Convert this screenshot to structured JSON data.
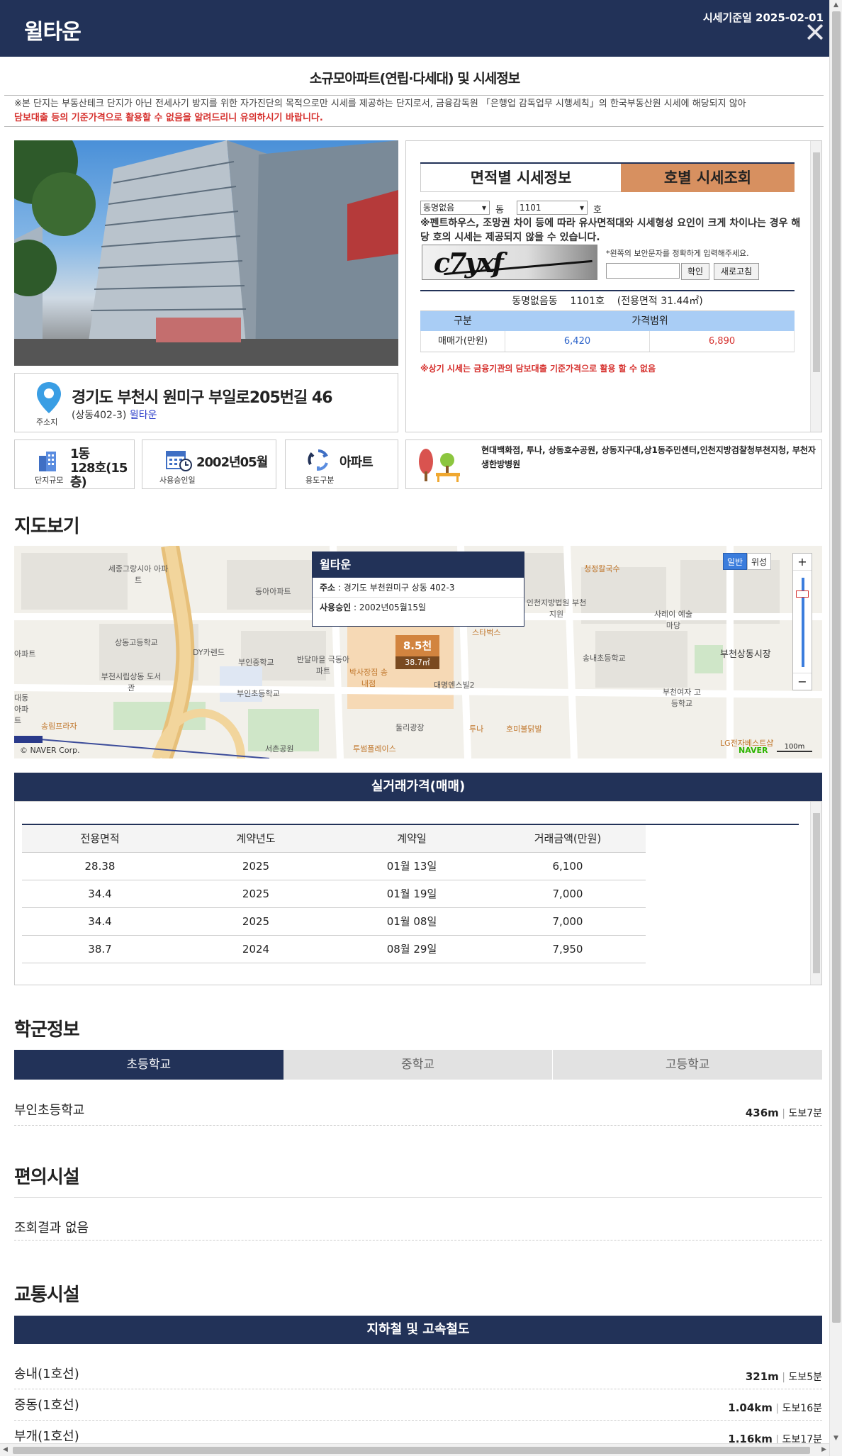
{
  "header": {
    "brand": "윌타운",
    "date_label": "시세기준일 2025-02-01",
    "close_icon": "close-icon"
  },
  "title": "소규모아파트(연립·다세대) 및 시세정보",
  "notice": {
    "line1": "※본 단지는 부동산테크 단지가 아닌 전세사기 방지를 위한 자가진단의 목적으로만 시세를 제공하는 단지로서, 금융감독원 「은행업 감독업무 시행세칙」의 한국부동산원 시세에 해당되지 않아",
    "line2": "담보대출 등의 기준가격으로 활용할 수 없음을 알려드리니 유의하시기 바랍니다."
  },
  "address": {
    "label": "주소지",
    "main": "경기도 부천시 원미구 부일로205번길 46",
    "sub_prefix": "(상동402-3)",
    "sub_link": "윌타운"
  },
  "price_panel": {
    "tab_area": "면적별 시세정보",
    "tab_unit": "호별 시세조회",
    "dong_value": "동명없음",
    "dong_suffix": "동",
    "ho_value": "1101",
    "ho_suffix": "호",
    "warning": "※펜트하우스, 조망권 차이 등에 따라 유사면적대와 시세형성 요인이 크게 차이나는 경우 해당 호의 시세는 제공되지 않을 수 있습니다.",
    "captcha_text": "c7yxf",
    "captcha_note": "*왼쪽의 보안문자를 정확하게 입력해주세요.",
    "confirm_btn": "확인",
    "refresh_btn": "새로고침",
    "result_caption": "동명없음동    1101호    (전용면적 31.44㎡)",
    "col_type": "구분",
    "col_range": "가격범위",
    "row_label": "매매가(만원)",
    "low": "6,420",
    "high": "6,890",
    "red_note": "※상기 시세는 금융기관의 담보대출 기준가격으로 활용 할 수 없음"
  },
  "info": {
    "scale_label": "단지규모",
    "scale_v1": "1동",
    "scale_v2": "128호(15층)",
    "approve_label": "사용승인일",
    "approve_value": "2002년05월",
    "use_label": "용도구분",
    "use_value": "아파트",
    "facilities": "현대백화점, 투나, 상동호수공원, 상동지구대,상1동주민센터,인천지방검찰청부천지청, 부천자생한방병원"
  },
  "map": {
    "section_title": "지도보기",
    "popup_title": "윌타운",
    "popup_addr_label": "주소",
    "popup_addr": " : 경기도 부천원미구 상동 402-3",
    "popup_date_label": "사용승인",
    "popup_date": " : 2002년05월15일",
    "marker_price": "8.5천",
    "marker_area": "38.7㎡",
    "btn_normal": "일반",
    "btn_sat": "위성",
    "zoom_in": "+",
    "zoom_out": "−",
    "copyright": "© NAVER Corp.",
    "scale": "100m",
    "naver": "NAVER",
    "labels": [
      "세종그랑시아 아파트",
      "동아아파트",
      "상동고등학교",
      "DY카렌드",
      "부인중학교",
      "반달마을 극동아파트",
      "박사장집 송내점",
      "부인초등학교",
      "부천시립상동 도서관",
      "대동 아파트",
      "송림프라자",
      "서촌공원",
      "투썸플레이스",
      "둘리광장",
      "대명엔스빌2",
      "투나",
      "호미불닭발",
      "스타벅스",
      "인천지방법원 부천지원",
      "사레이 예술마당",
      "송내초등학교",
      "부천상동시장",
      "부천여자 고등학교",
      "청정칼국수",
      "LG전자베스트샵",
      "아파트"
    ]
  },
  "transactions": {
    "title": "실거래가격(매매)",
    "headers": [
      "전용면적",
      "계약년도",
      "계약일",
      "거래금액(만원)"
    ],
    "rows": [
      [
        "28.38",
        "2025",
        "01월 13일",
        "6,100"
      ],
      [
        "34.4",
        "2025",
        "01월 19일",
        "7,000"
      ],
      [
        "34.4",
        "2025",
        "01월 08일",
        "7,000"
      ],
      [
        "38.7",
        "2024",
        "08월 29일",
        "7,950"
      ]
    ]
  },
  "school": {
    "title": "학군정보",
    "tabs": [
      "초등학교",
      "중학교",
      "고등학교"
    ],
    "name": "부인초등학교",
    "dist": "436m",
    "walk": "도보7분"
  },
  "convenience": {
    "title": "편의시설",
    "empty": "조회결과 없음"
  },
  "transport": {
    "title": "교통시설",
    "bar": "지하철 및 고속철도",
    "items": [
      {
        "name": "송내(1호선)",
        "dist": "321m",
        "walk": "도보5분"
      },
      {
        "name": "중동(1호선)",
        "dist": "1.04km",
        "walk": "도보16분"
      },
      {
        "name": "부개(1호선)",
        "dist": "1.16km",
        "walk": "도보17분"
      }
    ]
  },
  "colors": {
    "navy": "#223258",
    "orange": "#d79060",
    "red": "#d6312e",
    "lightblue": "#a9cdf5"
  }
}
